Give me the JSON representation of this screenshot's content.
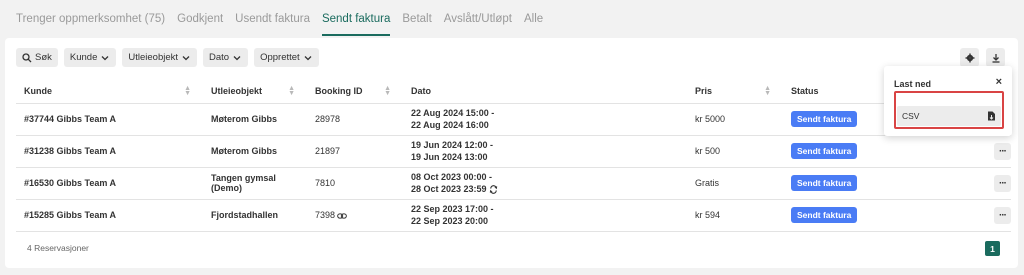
{
  "tabs": [
    {
      "label": "Trenger oppmerksomhet (75)",
      "active": false
    },
    {
      "label": "Godkjent",
      "active": false
    },
    {
      "label": "Usendt faktura",
      "active": false
    },
    {
      "label": "Sendt faktura",
      "active": true
    },
    {
      "label": "Betalt",
      "active": false
    },
    {
      "label": "Avslått/Utløpt",
      "active": false
    },
    {
      "label": "Alle",
      "active": false
    }
  ],
  "filters": {
    "search_label": "Søk",
    "kunde_label": "Kunde",
    "utleieobjekt_label": "Utleieobjekt",
    "dato_label": "Dato",
    "opprettet_label": "Opprettet"
  },
  "table": {
    "headers": [
      "Kunde",
      "Utleieobjekt",
      "Booking ID",
      "Dato",
      "Pris",
      "Status"
    ],
    "rows": [
      {
        "kunde": "#37744 Gibbs Team A",
        "objekt": "Møterom Gibbs",
        "booking": "28978",
        "date1": "22 Aug 2024 15:00 -",
        "date2": "22 Aug 2024 16:00",
        "pris": "kr 5000",
        "status": "Sendt faktura"
      },
      {
        "kunde": "#31238 Gibbs Team A",
        "objekt": "Møterom Gibbs",
        "booking": "21897",
        "date1": "19 Jun 2024 12:00 -",
        "date2": "19 Jun 2024 13:00",
        "pris": "kr 500",
        "status": "Sendt faktura"
      },
      {
        "kunde": "#16530 Gibbs Team A",
        "objekt": "Tangen gymsal (Demo)",
        "booking": "7810",
        "date1": "08 Oct 2023 00:00 -",
        "date2": "28 Oct 2023 23:59",
        "pris": "Gratis",
        "status": "Sendt faktura"
      },
      {
        "kunde": "#15285 Gibbs Team A",
        "objekt": "Fjordstadhallen",
        "booking": "7398",
        "date1": "22 Sep 2023 17:00 -",
        "date2": "22 Sep 2023 20:00",
        "pris": "kr 594",
        "status": "Sendt faktura"
      }
    ]
  },
  "footer": {
    "count_label": "4 Reservasjoner",
    "page": "1"
  },
  "download_popover": {
    "title": "Last ned",
    "close": "×",
    "option": "CSV"
  },
  "colors": {
    "accent": "#1a6b5e",
    "status": "#4a7cf5",
    "highlight": "#d94444"
  }
}
